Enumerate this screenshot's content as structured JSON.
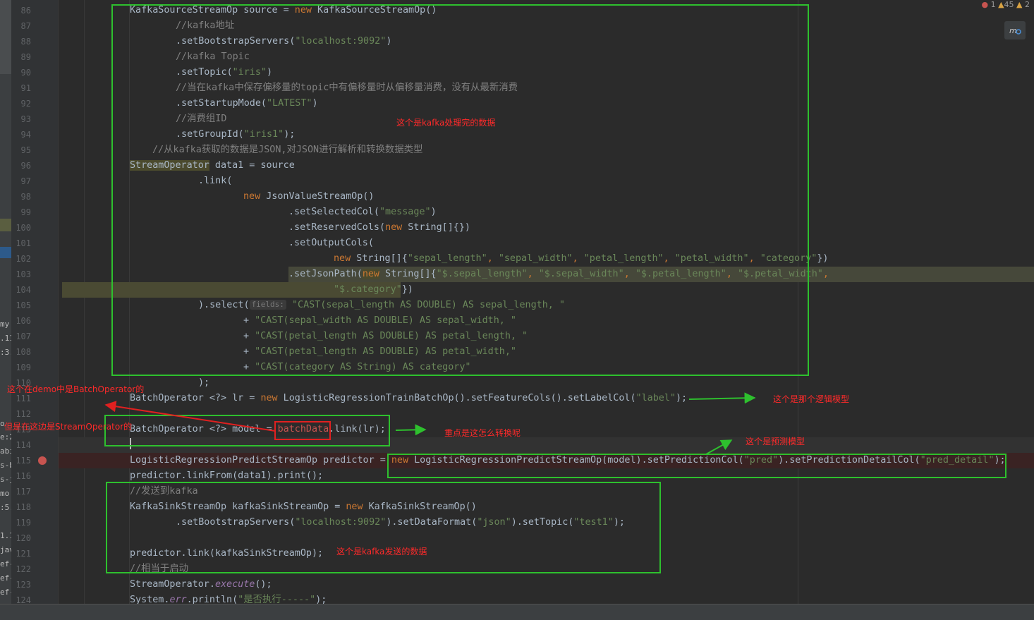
{
  "inspection": {
    "errors": "1",
    "warnings": "45",
    "weak": "2"
  },
  "left_strip": [
    "my",
    ".11",
    ":3.(",
    "o",
    "e:2.",
    "abi",
    "s-b",
    "s-j",
    "mo",
    ":5.(",
    "1.1",
    "jav",
    "ef-l",
    "ef-l",
    "ef-l"
  ],
  "line_numbers": [
    "86",
    "87",
    "88",
    "89",
    "90",
    "91",
    "92",
    "93",
    "94",
    "95",
    "96",
    "97",
    "98",
    "99",
    "100",
    "101",
    "102",
    "103",
    "104",
    "105",
    "106",
    "107",
    "108",
    "109",
    "110",
    "111",
    "112",
    "113",
    "114",
    "115",
    "116",
    "117",
    "118",
    "119",
    "120",
    "121",
    "122",
    "123",
    "124"
  ],
  "code": {
    "l86": {
      "a": "KafkaSourceStreamOp source = ",
      "kw": "new",
      "b": " KafkaSourceStreamOp()"
    },
    "l87": {
      "c": "//kafka地址"
    },
    "l88": {
      "a": ".setBootstrapServers(",
      "s": "\"localhost:9092\"",
      "b": ")"
    },
    "l89": {
      "c": "//kafka Topic"
    },
    "l90": {
      "a": ".setTopic(",
      "s": "\"iris\"",
      "b": ")"
    },
    "l91": {
      "c": "//当在kafka中保存偏移量的topic中有偏移量时从偏移量消费，没有从最新消费"
    },
    "l92": {
      "a": ".setStartupMode(",
      "s": "\"LATEST\"",
      "b": ")"
    },
    "l93": {
      "c": "//消费组ID"
    },
    "l94": {
      "a": ".setGroupId(",
      "s": "\"iris1\"",
      "b": ");"
    },
    "l95": {
      "c": "//从kafka获取的数据是JSON,对JSON进行解析和转换数据类型"
    },
    "l96": {
      "t": "StreamOperator",
      "b": " data1 = source"
    },
    "l97": {
      "a": ".link("
    },
    "l98": {
      "kw": "new",
      "b": " JsonValueStreamOp()"
    },
    "l99": {
      "a": ".setSelectedCol(",
      "s": "\"message\"",
      "b": ")"
    },
    "l100": {
      "a": ".setReservedCols(",
      "kw": "new",
      "b": " String[]{})"
    },
    "l101": {
      "a": ".setOutputCols("
    },
    "l102": {
      "kw": "new",
      "a": " String[]{",
      "s1": "\"sepal_length\"",
      "s2": "\"sepal_width\"",
      "s3": "\"petal_length\"",
      "s4": "\"petal_width\"",
      "s5": "\"category\"",
      "b": "})"
    },
    "l103": {
      "a": ".setJsonPath(",
      "kw": "new",
      "b": " String[]{",
      "s1": "\"$.sepal_length\"",
      "s2": "\"$.sepal_width\"",
      "s3": "\"$.petal_length\"",
      "s4": "\"$.petal_width\""
    },
    "l104": {
      "s": "\"$.category\"",
      "b": "})"
    },
    "l105": {
      "a": ").select(",
      "hint": "fields:",
      "s": "\"CAST(sepal_length AS DOUBLE) AS sepal_length, \""
    },
    "l106": {
      "a": "+ ",
      "s": "\"CAST(sepal_width AS DOUBLE) AS sepal_width, \""
    },
    "l107": {
      "a": "+ ",
      "s": "\"CAST(petal_length AS DOUBLE) AS petal_length, \""
    },
    "l108": {
      "a": "+ ",
      "s": "\"CAST(petal_length AS DOUBLE) AS petal_width,\""
    },
    "l109": {
      "a": "+ ",
      "s": "\"CAST(category AS String) AS category\""
    },
    "l110": {
      "a": ");"
    },
    "l111": {
      "a": "BatchOperator <?> lr = ",
      "kw": "new",
      "b": " LogisticRegressionTrainBatchOp().setFeatureCols().setLabelCol(",
      "s": "\"label\"",
      "e": ");"
    },
    "l113": {
      "a": "BatchOperator <?> model = ",
      "r": "batchData",
      "b": ".link(lr);"
    },
    "l115": {
      "a": "LogisticRegressionPredictStreamOp predictor = ",
      "kw": "new",
      "b": " LogisticRegressionPredictStreamOp(model).setPredictionCol(",
      "s1": "\"pred\"",
      "m": ").setPredictionDetailCol(",
      "s2": "\"pred_detail\"",
      "e": ");"
    },
    "l116": {
      "a": "predictor.linkFrom(data1).print();"
    },
    "l117": {
      "c": "//发送到kafka"
    },
    "l118": {
      "a": "KafkaSinkStreamOp kafkaSinkStreamOp = ",
      "kw": "new",
      "b": " KafkaSinkStreamOp()"
    },
    "l119": {
      "a": ".setBootstrapServers(",
      "s1": "\"localhost:9092\"",
      "m1": ").setDataFormat(",
      "s2": "\"json\"",
      "m2": ").setTopic(",
      "s3": "\"test1\"",
      "e": ");"
    },
    "l121": {
      "a": "predictor.link(kafkaSinkStreamOp);"
    },
    "l122": {
      "c": "//相当于启动"
    },
    "l123": {
      "a": "StreamOperator.",
      "i": "execute",
      "b": "();"
    },
    "l124": {
      "a": "System.",
      "i": "err",
      "b": ".println(",
      "s": "\"是否执行-----\"",
      "e": ");"
    }
  },
  "annotations": {
    "kafka_processed": "这个是kafka处理完的数据",
    "logic_model": "这个是那个逻辑模型",
    "how_convert": "重点是这怎么转换呢",
    "predict_model": "这个是预测模型",
    "kafka_sent": "这个是kafka发送的数据",
    "demo_batch": "这个在demo中是BatchOperator的",
    "here_stream": "但是在这边是StreamOperator的"
  },
  "colors": {
    "box": "#2ec02e",
    "annotation": "#ff2a2a",
    "keyword": "#cc7832",
    "string": "#6a8759",
    "comment": "#808080"
  }
}
